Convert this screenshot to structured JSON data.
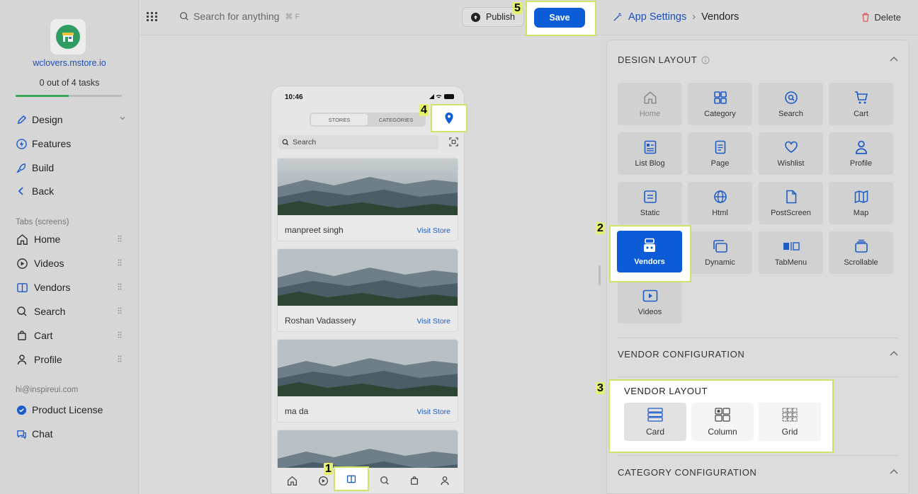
{
  "sidebar": {
    "domain": "wclovers.mstore.io",
    "tasks": "0 out of 4 tasks",
    "progress_fraction": 0.5,
    "nav": [
      {
        "label": "Design",
        "icon": "pen-icon"
      },
      {
        "label": "Features",
        "icon": "bolt-icon"
      },
      {
        "label": "Build",
        "icon": "rocket-icon"
      },
      {
        "label": "Back",
        "icon": "chevron-left-icon"
      }
    ],
    "tabs_label": "Tabs (screens)",
    "tabs": [
      {
        "label": "Home",
        "icon": "home-icon"
      },
      {
        "label": "Videos",
        "icon": "play-circle-icon"
      },
      {
        "label": "Vendors",
        "icon": "book-open-icon"
      },
      {
        "label": "Search",
        "icon": "search-icon"
      },
      {
        "label": "Cart",
        "icon": "bag-icon"
      },
      {
        "label": "Profile",
        "icon": "user-icon"
      }
    ],
    "email": "hi@inspireui.com",
    "license": "Product License",
    "chat": "Chat"
  },
  "topbar": {
    "search_placeholder": "Search for anything",
    "shortcut": "⌘ F",
    "publish": "Publish",
    "save": "Save"
  },
  "phone": {
    "time": "10:46",
    "segments": [
      "STORES",
      "CATEGORIES"
    ],
    "search_placeholder": "Search",
    "visit_label": "Visit Store",
    "stores": [
      "manpreet singh",
      "Roshan Vadassery",
      "ma da"
    ]
  },
  "badges": {
    "b1": "1",
    "b2": "2",
    "b3": "3",
    "b4": "4",
    "b5": "5"
  },
  "right": {
    "breadcrumb_root": "App Settings",
    "breadcrumb_current": "Vendors",
    "delete": "Delete",
    "design_layout_title": "DESIGN LAYOUT",
    "tiles": {
      "home": "Home",
      "category": "Category",
      "search": "Search",
      "cart": "Cart",
      "listblog": "List Blog",
      "page": "Page",
      "wishlist": "Wishlist",
      "profile": "Profile",
      "static": "Static",
      "html": "Html",
      "postscreen": "PostScreen",
      "map": "Map",
      "vendors": "Vendors",
      "dynamic": "Dynamic",
      "tabmenu": "TabMenu",
      "scrollable": "Scrollable",
      "videos": "Videos"
    },
    "vendor_config_title": "VENDOR CONFIGURATION",
    "vendor_layout_title": "VENDOR LAYOUT",
    "layouts": {
      "card": "Card",
      "column": "Column",
      "grid": "Grid"
    },
    "category_config_title": "CATEGORY CONFIGURATION"
  },
  "colors": {
    "accent": "#0b5cd6",
    "highlight": "#cfe26a",
    "link": "#1d4fb8"
  }
}
